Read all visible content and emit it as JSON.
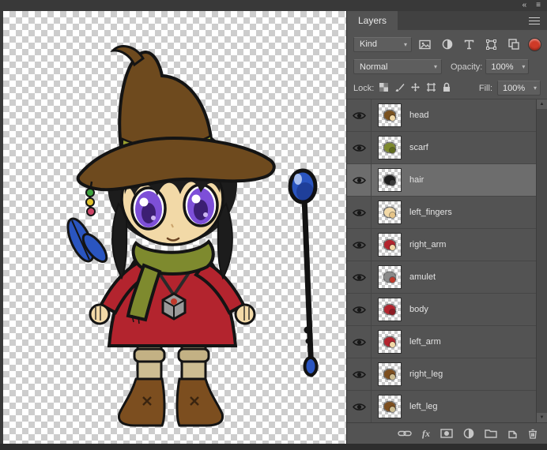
{
  "titlebar": {
    "collapse_icon": "«",
    "menu_icon": "≡"
  },
  "glyphs": {
    "chevron": "▾",
    "scroll_up": "▲",
    "scroll_down": "▼"
  },
  "panel": {
    "tab_label": "Layers",
    "filter": {
      "kind_label": "Kind",
      "toggle_color": "#cf3a27"
    },
    "blend": {
      "mode": "Normal",
      "opacity_label": "Opacity:",
      "opacity_value": "100%"
    },
    "lock": {
      "label": "Lock:",
      "fill_label": "Fill:",
      "fill_value": "100%"
    },
    "layers": [
      {
        "name": "head",
        "selected": false,
        "thumb_primary": "#7a5220",
        "thumb_secondary": "#f2d9a7"
      },
      {
        "name": "scarf",
        "selected": false,
        "thumb_primary": "#7e8a2e",
        "thumb_secondary": "#5f6a1e"
      },
      {
        "name": "hair",
        "selected": true,
        "thumb_primary": "#1e1e1e",
        "thumb_secondary": "#3a3a3a"
      },
      {
        "name": "left_fingers",
        "selected": false,
        "thumb_primary": "#f2d9a7",
        "thumb_secondary": "#e6c488"
      },
      {
        "name": "right_arm",
        "selected": false,
        "thumb_primary": "#b3242e",
        "thumb_secondary": "#f2d9a7"
      },
      {
        "name": "amulet",
        "selected": false,
        "thumb_primary": "#8a8a8a",
        "thumb_secondary": "#c0392b"
      },
      {
        "name": "body",
        "selected": false,
        "thumb_primary": "#b3242e",
        "thumb_secondary": "#8a1b22"
      },
      {
        "name": "left_arm",
        "selected": false,
        "thumb_primary": "#b3242e",
        "thumb_secondary": "#f2d9a7"
      },
      {
        "name": "right_leg",
        "selected": false,
        "thumb_primary": "#7c4e1f",
        "thumb_secondary": "#cdbd92"
      },
      {
        "name": "left_leg",
        "selected": false,
        "thumb_primary": "#7c4e1f",
        "thumb_secondary": "#cdbd92"
      }
    ],
    "footer": {
      "fx_label": "fx"
    }
  },
  "canvas": {
    "colors": {
      "skin": "#f2d9a7",
      "hat": "#6e4a1e",
      "band": "#9aa12f",
      "dress": "#b3242e",
      "scarf": "#7e8a2e",
      "sock": "#cdbd92",
      "sock-dark": "#c3b184",
      "boot": "#7c4e1f",
      "eye-purple": "#7d4fd8",
      "staff-blue": "#2a55c0"
    }
  }
}
